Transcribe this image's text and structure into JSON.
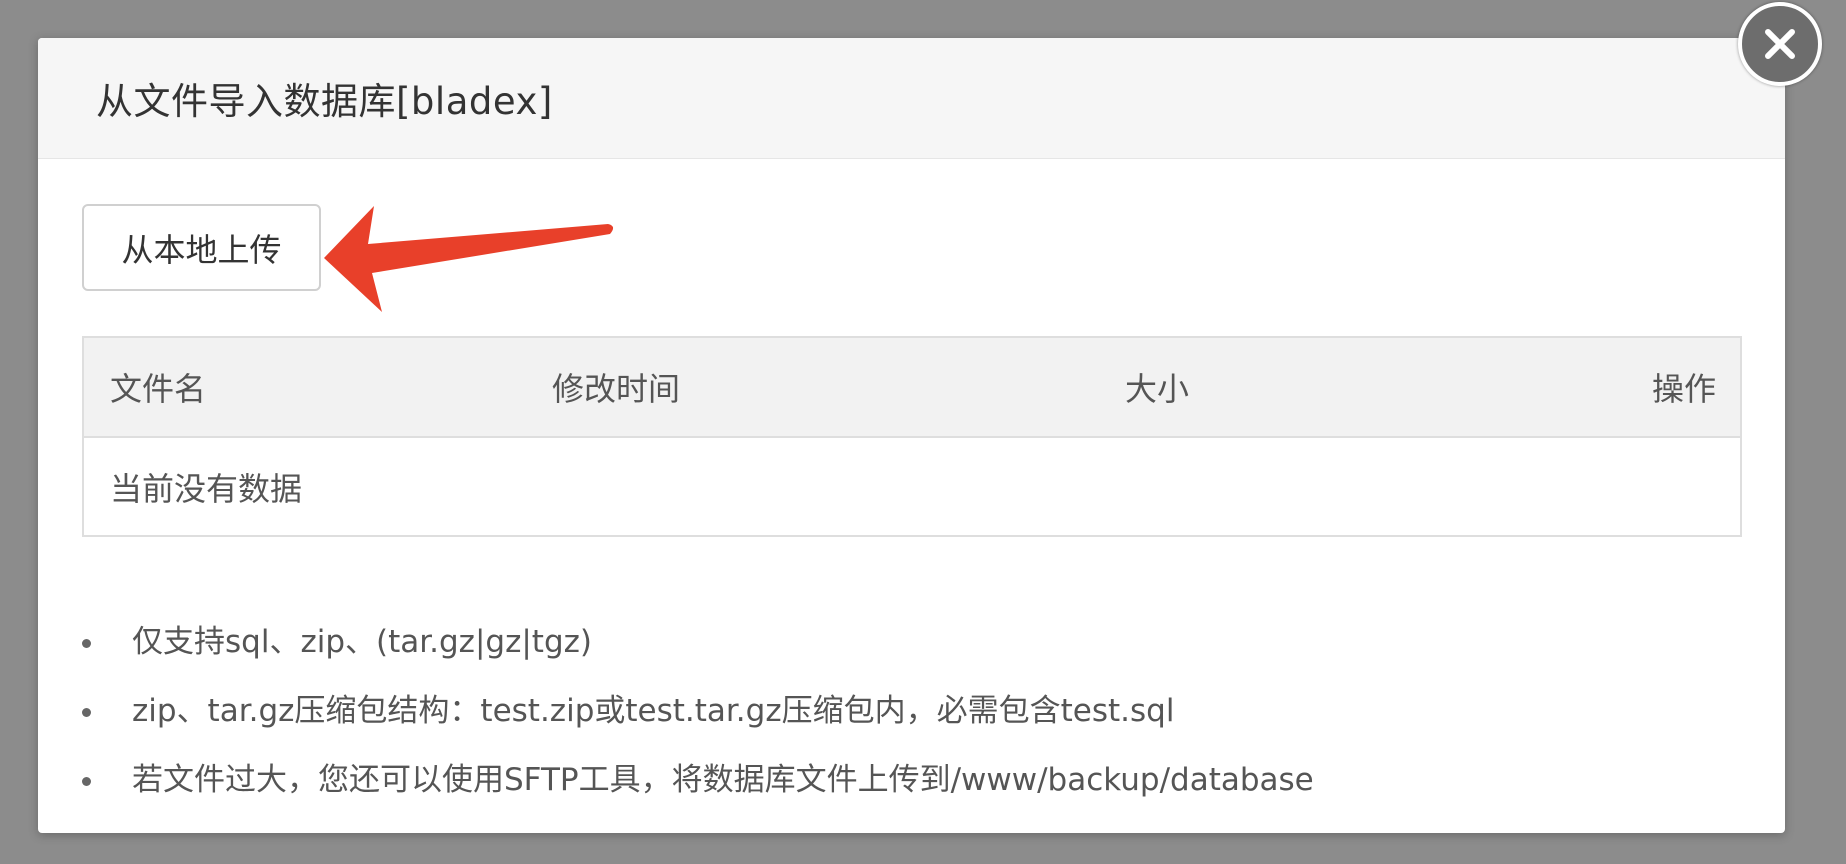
{
  "dialog": {
    "title": "从文件导入数据库[bladex]",
    "close_icon": "close-icon"
  },
  "upload": {
    "label": "从本地上传"
  },
  "annotation": {
    "color": "#e8402a"
  },
  "table": {
    "columns": [
      "文件名",
      "修改时间",
      "大小",
      "操作"
    ],
    "empty_text": "当前没有数据"
  },
  "notes": [
    "仅支持sql、zip、(tar.gz|gz|tgz)",
    "zip、tar.gz压缩包结构：test.zip或test.tar.gz压缩包内，必需包含test.sql",
    "若文件过大，您还可以使用SFTP工具，将数据库文件上传到/www/backup/database"
  ]
}
